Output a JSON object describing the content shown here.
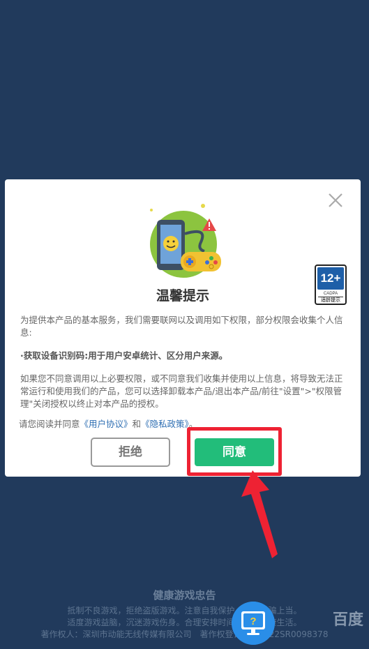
{
  "dialog": {
    "title": "温馨提示",
    "paragraph1": "为提供本产品的基本服务，我们需要联网以及调用如下权限，部分权限会收集个人信息:",
    "paragraph2": "·获取设备识别码:用于用户安卓统计、区分用户来源。",
    "paragraph3": "如果您不同意调用以上必要权限，或不同意我们收集并使用以上信息，将导致无法正常运行和使用我们的产品，您可以选择卸载本产品/退出本产品/前往\"设置\">\"权限管理\"关闭授权以终止对本产品的授权。",
    "consent_prefix": "请您阅读并同意",
    "user_agreement": "《用户协议》",
    "consent_and": "和",
    "privacy_policy": "《隐私政策》",
    "consent_suffix": "。",
    "reject_label": "拒绝",
    "agree_label": "同意",
    "close_icon": "close-icon"
  },
  "age_badge": {
    "age": "12+",
    "org": "CADPA",
    "note": "适龄提示"
  },
  "footer": {
    "title": "健康游戏忠告",
    "line1": "抵制不良游戏，拒绝盗版游戏。注意自我保护，谨防受骗上当。",
    "line2": "适度游戏益脑，沉迷游戏伤身。合理安排时间，享受健康生活。",
    "line3": "著作权人：深圳市动能无线传媒有限公司　著作权登记号：2022SR0098378"
  },
  "watermark": "百度",
  "colors": {
    "background": "#213a5c",
    "agree": "#22bd7a",
    "highlight": "#ee2233",
    "link": "#2f6fb3"
  }
}
